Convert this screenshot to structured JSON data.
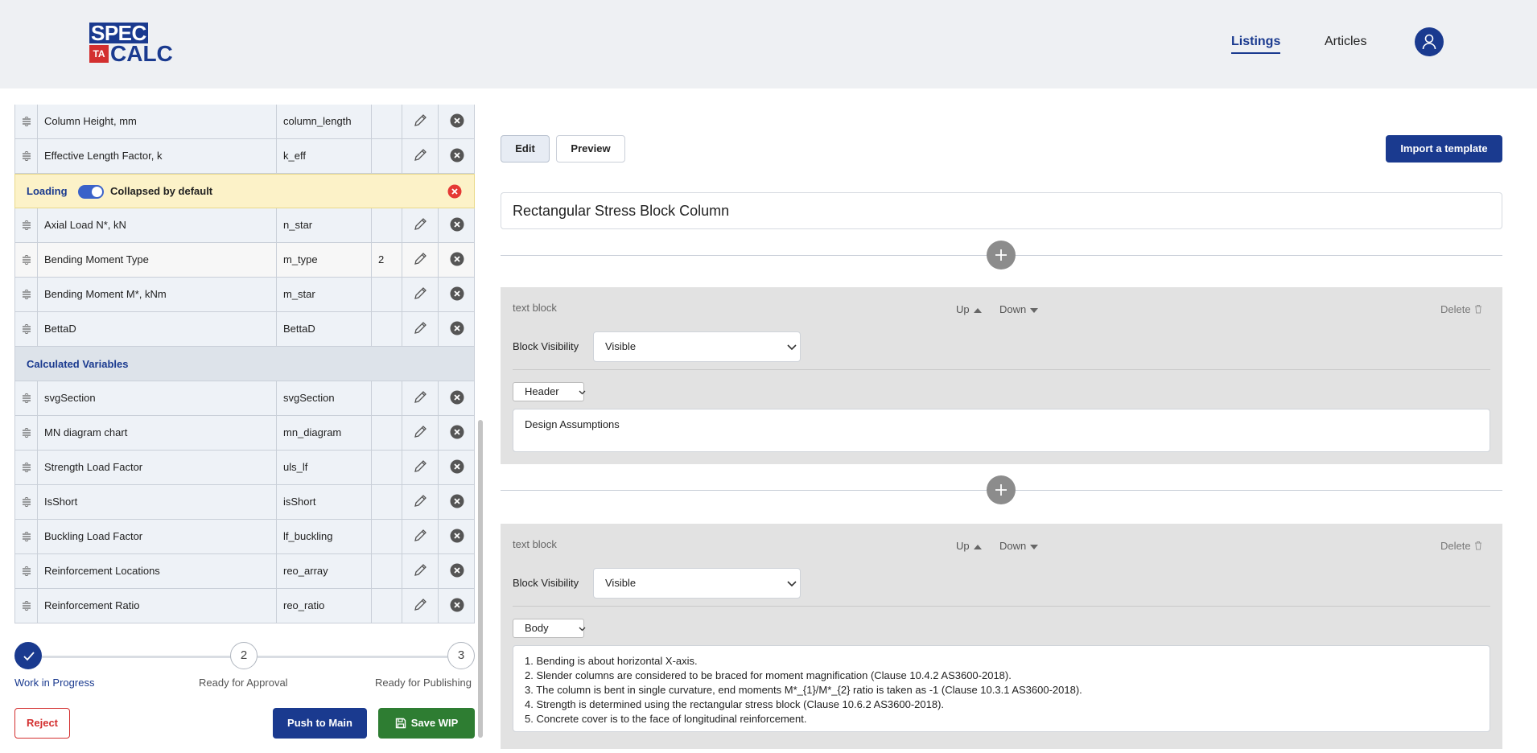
{
  "header": {
    "logo_top": "SPEC",
    "logo_ta": "TA",
    "logo_bottom": "CALC",
    "nav": [
      {
        "label": "Listings",
        "active": true
      },
      {
        "label": "Articles",
        "active": false
      }
    ],
    "avatar_icon": "user-icon"
  },
  "variables": {
    "top_rows": [
      {
        "label": "Column Height, mm",
        "code": "column_length",
        "extra": ""
      },
      {
        "label": "Effective Length Factor, k",
        "code": "k_eff",
        "extra": ""
      }
    ],
    "loading_section": {
      "label": "Loading",
      "toggle_label": "Collapsed by default",
      "toggle_on": true
    },
    "loading_rows": [
      {
        "label": "Axial Load N*, kN",
        "code": "n_star",
        "extra": ""
      },
      {
        "label": "Bending Moment Type",
        "code": "m_type",
        "extra": "2"
      },
      {
        "label": "Bending Moment M*, kNm",
        "code": "m_star",
        "extra": ""
      },
      {
        "label": "BettaD",
        "code": "BettaD",
        "extra": ""
      }
    ],
    "calc_section": {
      "label": "Calculated Variables"
    },
    "calc_rows": [
      {
        "label": "svgSection",
        "code": "svgSection",
        "extra": ""
      },
      {
        "label": "MN diagram chart",
        "code": "mn_diagram",
        "extra": ""
      },
      {
        "label": "Strength Load Factor",
        "code": "uls_lf",
        "extra": ""
      },
      {
        "label": "IsShort",
        "code": "isShort",
        "extra": ""
      },
      {
        "label": "Buckling Load Factor",
        "code": "lf_buckling",
        "extra": ""
      },
      {
        "label": "Reinforcement Locations",
        "code": "reo_array",
        "extra": ""
      },
      {
        "label": "Reinforcement Ratio",
        "code": "reo_ratio",
        "extra": ""
      }
    ]
  },
  "workflow": {
    "steps": [
      {
        "number": "1",
        "label": "Work in Progress",
        "done": true
      },
      {
        "number": "2",
        "label": "Ready for Approval",
        "done": false
      },
      {
        "number": "3",
        "label": "Ready for Publishing",
        "done": false
      }
    ],
    "reject_label": "Reject",
    "push_label": "Push to Main",
    "save_label": "Save WIP"
  },
  "editor": {
    "tabs": [
      {
        "label": "Edit",
        "active": true
      },
      {
        "label": "Preview",
        "active": false
      }
    ],
    "import_label": "Import a template",
    "title": "Rectangular Stress Block Column",
    "blocks": [
      {
        "type": "text block",
        "up_label": "Up",
        "down_label": "Down",
        "delete_label": "Delete",
        "visibility_label": "Block Visibility",
        "visibility": "Visible",
        "style": "Header",
        "lines": [
          "Design Assumptions"
        ]
      },
      {
        "type": "text block",
        "up_label": "Up",
        "down_label": "Down",
        "delete_label": "Delete",
        "visibility_label": "Block Visibility",
        "visibility": "Visible",
        "style": "Body",
        "lines": [
          "1. Bending is about horizontal X-axis.",
          "2. Slender columns are considered to be braced for moment magnification (Clause 10.4.2 AS3600-2018).",
          "3. The column is bent in single curvature, end moments M*_{1}/M*_{2} ratio is taken as -1 (Clause 10.3.1 AS3600-2018).",
          "4. Strength is determined using the rectangular stress block (Clause 10.6.2 AS3600-2018).",
          "5. Concrete cover is to the face of longitudinal reinforcement."
        ]
      }
    ]
  },
  "colors": {
    "brand": "#1a3a8f",
    "danger": "#d32f2f",
    "success": "#2e7d32",
    "loading_bg": "#fcf2c8"
  }
}
